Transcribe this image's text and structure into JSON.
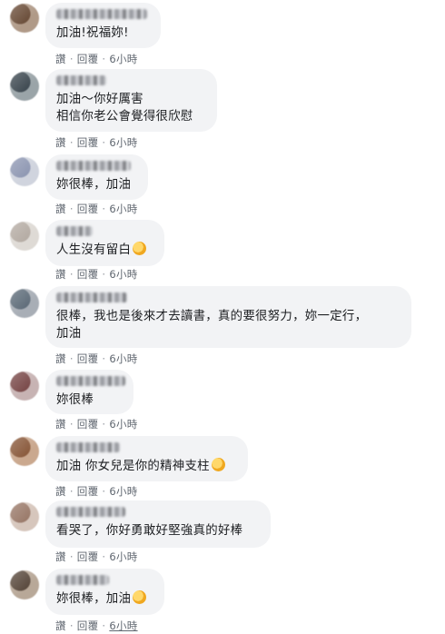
{
  "actions": {
    "like": "讚",
    "reply": "回覆",
    "time": "6小時",
    "sep": "·"
  },
  "comments": [
    {
      "text": "加油!祝福妳!",
      "emoji": false
    },
    {
      "text": "加油～你好厲害\n相信你老公會覺得很欣慰",
      "emoji": false
    },
    {
      "text": "妳很棒，加油",
      "emoji": false
    },
    {
      "text": "人生沒有留白",
      "emoji": true,
      "emoji_name": "clapping-hands-icon"
    },
    {
      "text": "很棒，我也是後來才去讀書，真的要很努力，妳一定行，\n加油",
      "emoji": false
    },
    {
      "text": "妳很棒",
      "emoji": false
    },
    {
      "text": "加油 你女兒是你的精神支柱",
      "emoji": true,
      "emoji_name": "flexed-biceps-icon"
    },
    {
      "text": "看哭了，你好勇敢好堅強真的好棒",
      "emoji": false
    },
    {
      "text": "妳很棒，加油",
      "emoji": true,
      "emoji_name": "flexed-biceps-icon"
    }
  ]
}
